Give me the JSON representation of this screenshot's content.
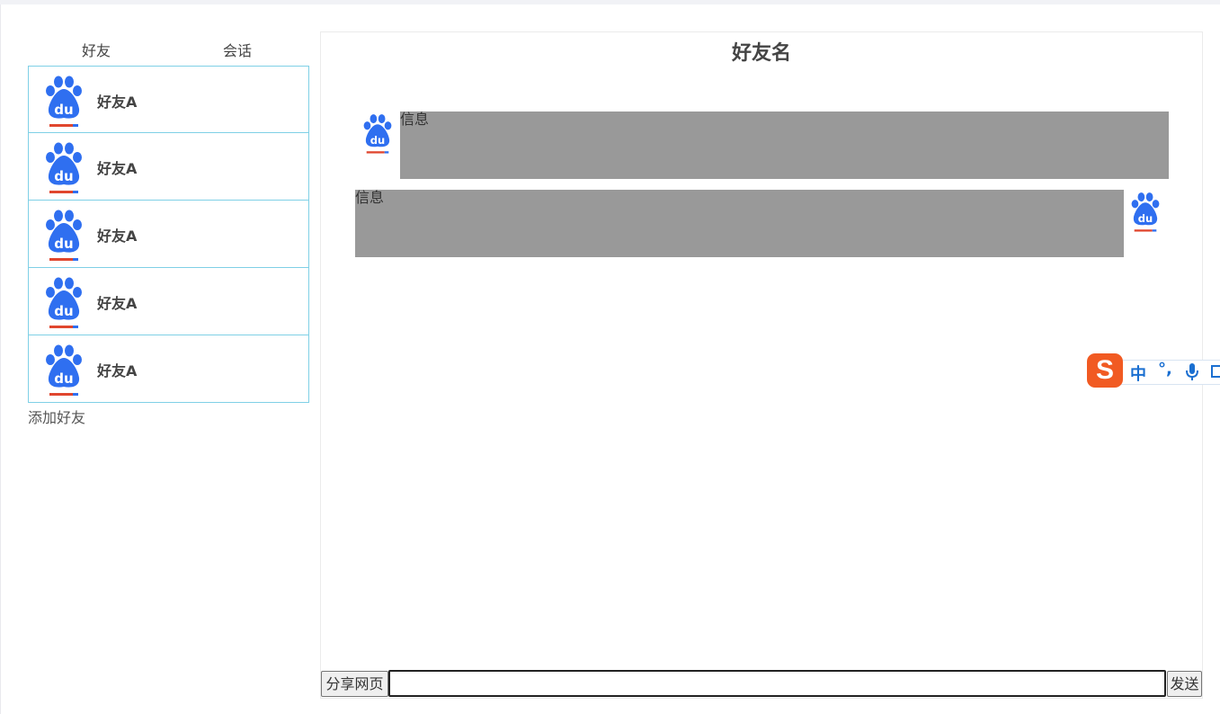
{
  "tabs": {
    "friends": "好友",
    "chats": "会话"
  },
  "friend_list": [
    {
      "name": "好友A",
      "avatar_icon": "baidu-paw-icon"
    },
    {
      "name": "好友A",
      "avatar_icon": "baidu-paw-icon"
    },
    {
      "name": "好友A",
      "avatar_icon": "baidu-paw-icon"
    },
    {
      "name": "好友A",
      "avatar_icon": "baidu-paw-icon"
    },
    {
      "name": "好友A",
      "avatar_icon": "baidu-paw-icon"
    }
  ],
  "add_friend_label": "添加好友",
  "chat": {
    "title": "好友名",
    "messages": [
      {
        "side": "left",
        "text": "信息",
        "avatar_icon": "baidu-paw-icon"
      },
      {
        "side": "right",
        "text": "信息",
        "avatar_icon": "baidu-paw-icon"
      }
    ]
  },
  "composer": {
    "share_label": "分享网页",
    "input_value": "",
    "send_label": "发送"
  },
  "ime": {
    "logo_icon": "sogou-s-icon",
    "mode_label": "中",
    "punct_label": "°,",
    "mic_icon": "microphone-icon",
    "keyboard_icon": "keyboard-icon"
  },
  "colors": {
    "bubble": "#999999",
    "list_border": "#7fd0e6",
    "paw_blue": "#2f6ff0",
    "paw_red": "#e0462e"
  }
}
